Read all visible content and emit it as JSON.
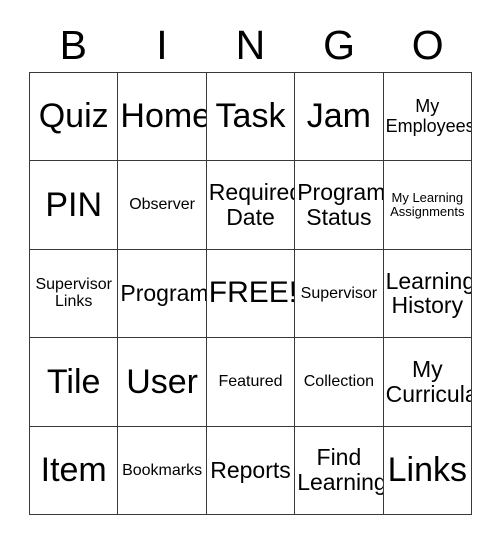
{
  "card": {
    "title": "BINGO",
    "free_space_label": "FREE!",
    "border_color": "#3a3a3a",
    "text_color": "#000000",
    "background_color": "#ffffff",
    "columns": 5,
    "rows": 5
  },
  "header": {
    "letters": [
      "B",
      "I",
      "N",
      "G",
      "O"
    ]
  },
  "grid": {
    "rows": [
      {
        "cells": [
          {
            "label": "Quiz",
            "size": "fs-xl",
            "free": false
          },
          {
            "label": "Home",
            "size": "fs-xl",
            "free": false
          },
          {
            "label": "Task",
            "size": "fs-xl",
            "free": false
          },
          {
            "label": "Jam",
            "size": "fs-xl",
            "free": false
          },
          {
            "label": "My\nEmployees",
            "size": "fs-sm",
            "free": false
          }
        ]
      },
      {
        "cells": [
          {
            "label": "PIN",
            "size": "fs-xl",
            "free": false
          },
          {
            "label": "Observer",
            "size": "fs-xs",
            "free": false
          },
          {
            "label": "Required\nDate",
            "size": "fs-md",
            "free": false
          },
          {
            "label": "Program\nStatus",
            "size": "fs-md",
            "free": false
          },
          {
            "label": "My Learning\nAssignments",
            "size": "fs-xxs",
            "free": false
          }
        ]
      },
      {
        "cells": [
          {
            "label": "Supervisor\nLinks",
            "size": "fs-xs",
            "free": false
          },
          {
            "label": "Program",
            "size": "fs-md",
            "free": false
          },
          {
            "label": "FREE!",
            "size": "fs-lg",
            "free": true
          },
          {
            "label": "Supervisor",
            "size": "fs-xs",
            "free": false
          },
          {
            "label": "Learning\nHistory",
            "size": "fs-md",
            "free": false
          }
        ]
      },
      {
        "cells": [
          {
            "label": "Tile",
            "size": "fs-xl",
            "free": false
          },
          {
            "label": "User",
            "size": "fs-xl",
            "free": false
          },
          {
            "label": "Featured",
            "size": "fs-xs",
            "free": false
          },
          {
            "label": "Collection",
            "size": "fs-xs",
            "free": false
          },
          {
            "label": "My\nCurricula",
            "size": "fs-md",
            "free": false
          }
        ]
      },
      {
        "cells": [
          {
            "label": "Item",
            "size": "fs-xl",
            "free": false
          },
          {
            "label": "Bookmarks",
            "size": "fs-xs",
            "free": false
          },
          {
            "label": "Reports",
            "size": "fs-md",
            "free": false
          },
          {
            "label": "Find\nLearning",
            "size": "fs-md",
            "free": false
          },
          {
            "label": "Links",
            "size": "fs-xl",
            "free": false
          }
        ]
      }
    ]
  }
}
